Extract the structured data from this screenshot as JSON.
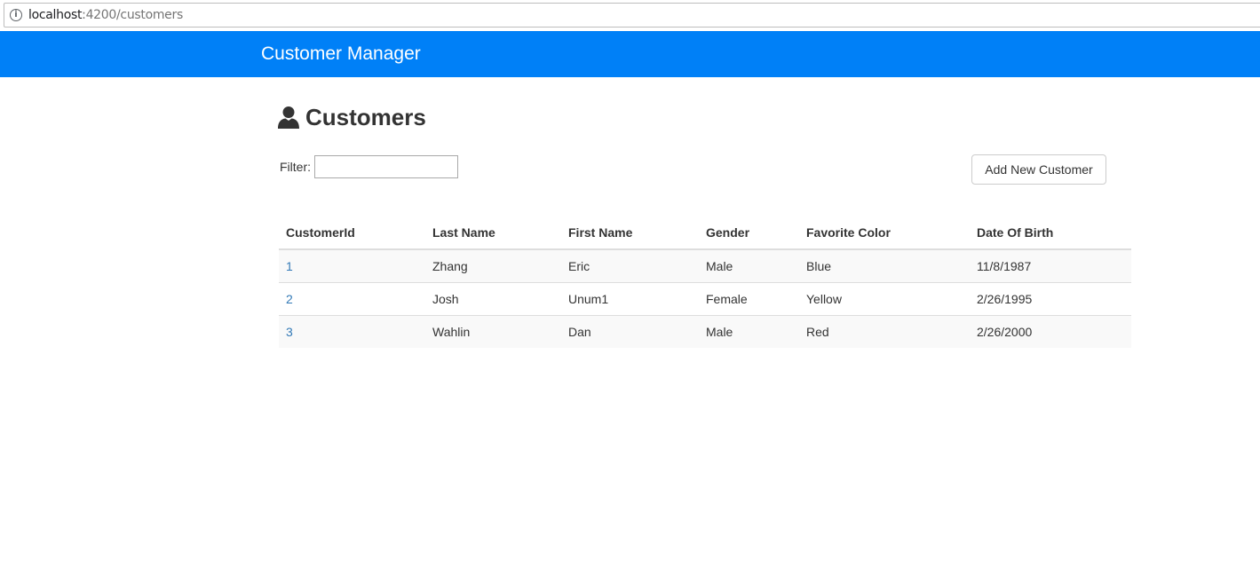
{
  "browser": {
    "url_host": "localhost",
    "url_path": ":4200/customers",
    "info_icon": "info-icon"
  },
  "navbar": {
    "brand": "Customer Manager",
    "color": "#0080f7"
  },
  "page": {
    "icon": "user-icon",
    "title": "Customers"
  },
  "filter": {
    "label": "Filter:",
    "value": "",
    "placeholder": ""
  },
  "actions": {
    "add_label": "Add New Customer"
  },
  "table": {
    "headers": [
      "CustomerId",
      "Last Name",
      "First Name",
      "Gender",
      "Favorite Color",
      "Date Of Birth"
    ],
    "rows": [
      [
        "1",
        "Zhang",
        "Eric",
        "Male",
        "Blue",
        "11/8/1987"
      ],
      [
        "2",
        "Josh",
        "Unum1",
        "Female",
        "Yellow",
        "2/26/1995"
      ],
      [
        "3",
        "Wahlin",
        "Dan",
        "Male",
        "Red",
        "2/26/2000"
      ]
    ],
    "link_color": "#337ab7"
  }
}
